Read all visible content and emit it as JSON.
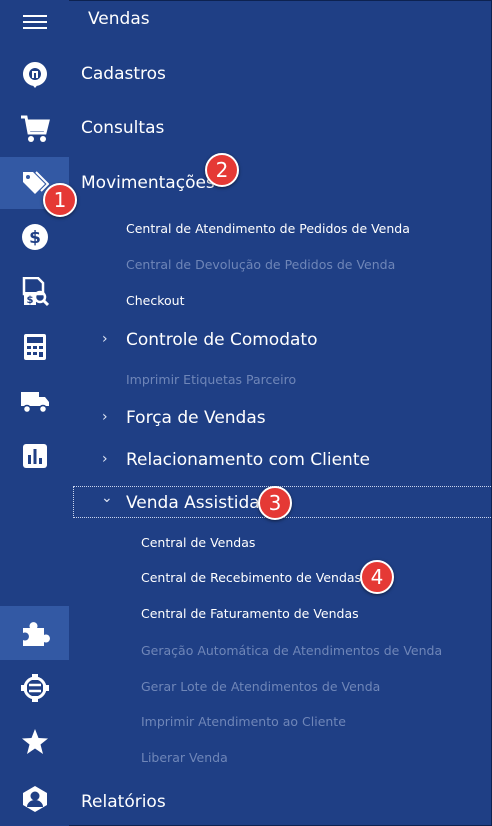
{
  "header": {
    "title": "Vendas"
  },
  "menu": {
    "cadastros": "Cadastros",
    "consultas": "Consultas",
    "movimentacoes": "Movimentações",
    "relatorios": "Relatórios"
  },
  "movimentacoes_items": {
    "central_atendimento": "Central de Atendimento de Pedidos de Venda",
    "central_devolucao": "Central de Devolução de Pedidos de Venda",
    "checkout": "Checkout",
    "controle_comodato": "Controle de Comodato",
    "imprimir_etiquetas": "Imprimir Etiquetas Parceiro",
    "forca_vendas": "Força de Vendas",
    "relacionamento": "Relacionamento com Cliente",
    "venda_assistida": "Venda Assistida"
  },
  "venda_assistida_items": {
    "central_vendas": "Central de Vendas",
    "central_recebimento": "Central de Recebimento de Vendas",
    "central_faturamento": "Central de Faturamento de Vendas",
    "geracao_automatica": "Geração Automática de Atendimentos de Venda",
    "gerar_lote": "Gerar Lote de Atendimentos de Venda",
    "imprimir_atendimento": "Imprimir Atendimento ao Cliente",
    "liberar_venda": "Liberar Venda"
  },
  "chevrons": {
    "collapsed": "›",
    "expanded": "⌄"
  },
  "callouts": [
    "1",
    "2",
    "3",
    "4"
  ],
  "colors": {
    "background": "#1f3f85",
    "active_rail": "#3359a4",
    "disabled_text": "#6f86b8",
    "callout": "#e53935"
  },
  "icons": [
    "menu-icon",
    "register-icon",
    "cart-icon",
    "tags-icon",
    "dollar-icon",
    "document-search-icon",
    "calculator-icon",
    "truck-icon",
    "chart-icon",
    "puzzle-icon",
    "integration-icon",
    "star-icon",
    "user-circle-icon"
  ]
}
